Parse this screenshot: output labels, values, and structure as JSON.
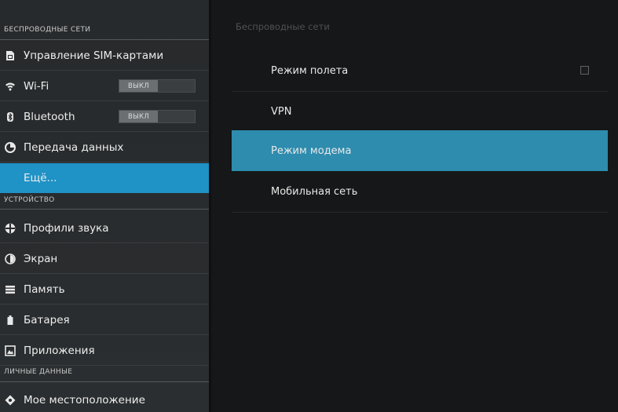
{
  "sidebar": {
    "section_wireless": "БЕСПРОВОДНЫЕ СЕТИ",
    "section_device": "УСТРОЙСТВО",
    "section_personal": "ЛИЧНЫЕ ДАННЫЕ",
    "items": [
      {
        "label": "Управление SIM-картами",
        "icon": "sim-card-icon"
      },
      {
        "label": "Wi-Fi",
        "icon": "wifi-icon",
        "toggle": "ВЫКЛ"
      },
      {
        "label": "Bluetooth",
        "icon": "bluetooth-icon",
        "toggle": "ВЫКЛ"
      },
      {
        "label": "Передача данных",
        "icon": "data-usage-icon"
      },
      {
        "label": "Ещё...",
        "selected": true
      },
      {
        "label": "Профили звука",
        "icon": "sound-icon"
      },
      {
        "label": "Экран",
        "icon": "display-icon"
      },
      {
        "label": "Память",
        "icon": "storage-icon"
      },
      {
        "label": "Батарея",
        "icon": "battery-icon"
      },
      {
        "label": "Приложения",
        "icon": "apps-icon"
      },
      {
        "label": "Мое местоположение",
        "icon": "location-icon"
      }
    ]
  },
  "main": {
    "title": "Беспроводные сети",
    "prefs": [
      {
        "label": "Режим полета",
        "checked": false
      },
      {
        "label": "VPN"
      },
      {
        "label": "Режим модема",
        "selected": true
      },
      {
        "label": "Мобильная сеть"
      }
    ]
  },
  "colors": {
    "accent": "#1f92c6",
    "highlight": "#2e8cae",
    "sidebar_bg": "#2a2d2f",
    "main_bg": "#151718"
  }
}
